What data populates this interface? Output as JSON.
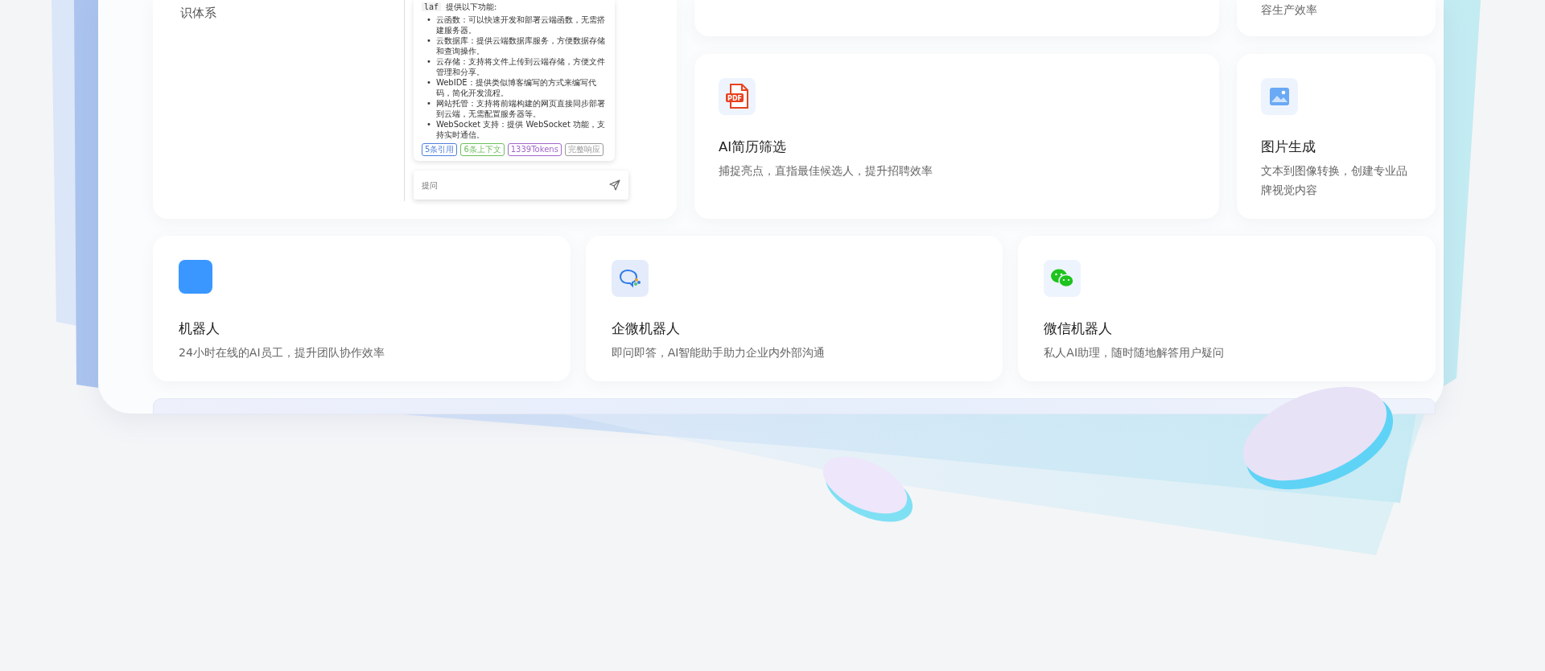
{
  "knowledge_card": {
    "text_fragment": "识体系",
    "chat": {
      "intro_code": "laf",
      "intro": "提供以下功能:",
      "items": [
        {
          "marker": "•",
          "text": "云函数：可以快速开发和部署云端函数，无需搭建服务器。"
        },
        {
          "marker": "•",
          "text": "云数据库：提供云端数据库服务，方便数据存储和查询操作。"
        },
        {
          "marker": "•",
          "text": "云存储：支持将文件上传到云端存储，方便文件管理和分享。"
        },
        {
          "marker": "•",
          "text": "WebIDE：提供类似博客编写的方式来编写代码，简化开发流程。"
        },
        {
          "marker": "•",
          "text": "网站托管：支持将前端构建的网页直接同步部署到云端，无需配置服务器等。"
        },
        {
          "marker": "•",
          "text": "WebSocket 支持：提供 WebSocket 功能，支持实时通信。"
        }
      ],
      "tags": [
        {
          "label": "5条引用",
          "color": "#4f7fdc"
        },
        {
          "label": "6条上下文",
          "color": "#6cbf5a"
        },
        {
          "label": "1339Tokens",
          "color": "#a067c9"
        },
        {
          "label": "完整响应",
          "color": "#999999"
        }
      ],
      "input": {
        "placeholder": "提问"
      }
    }
  },
  "top_right_card": {
    "description_fragment": "容生产效率"
  },
  "feature_cards": [
    {
      "kind": "pdf",
      "icon_label": "PDF",
      "title": "AI简历筛选",
      "description": "捕捉亮点，直指最佳候选人，提升招聘效率"
    },
    {
      "kind": "image",
      "title": "图片生成",
      "description": "文本到图像转换，创建专业品牌视觉内容"
    },
    {
      "kind": "square",
      "title": "机器人",
      "description": "24小时在线的AI员工，提升团队协作效率"
    },
    {
      "kind": "chat",
      "title": "企微机器人",
      "description": "即问即答，AI智能助手助力企业内外部沟通"
    },
    {
      "kind": "wechat",
      "title": "微信机器人",
      "description": "私人AI助理，随时随地解答用户疑问"
    }
  ]
}
